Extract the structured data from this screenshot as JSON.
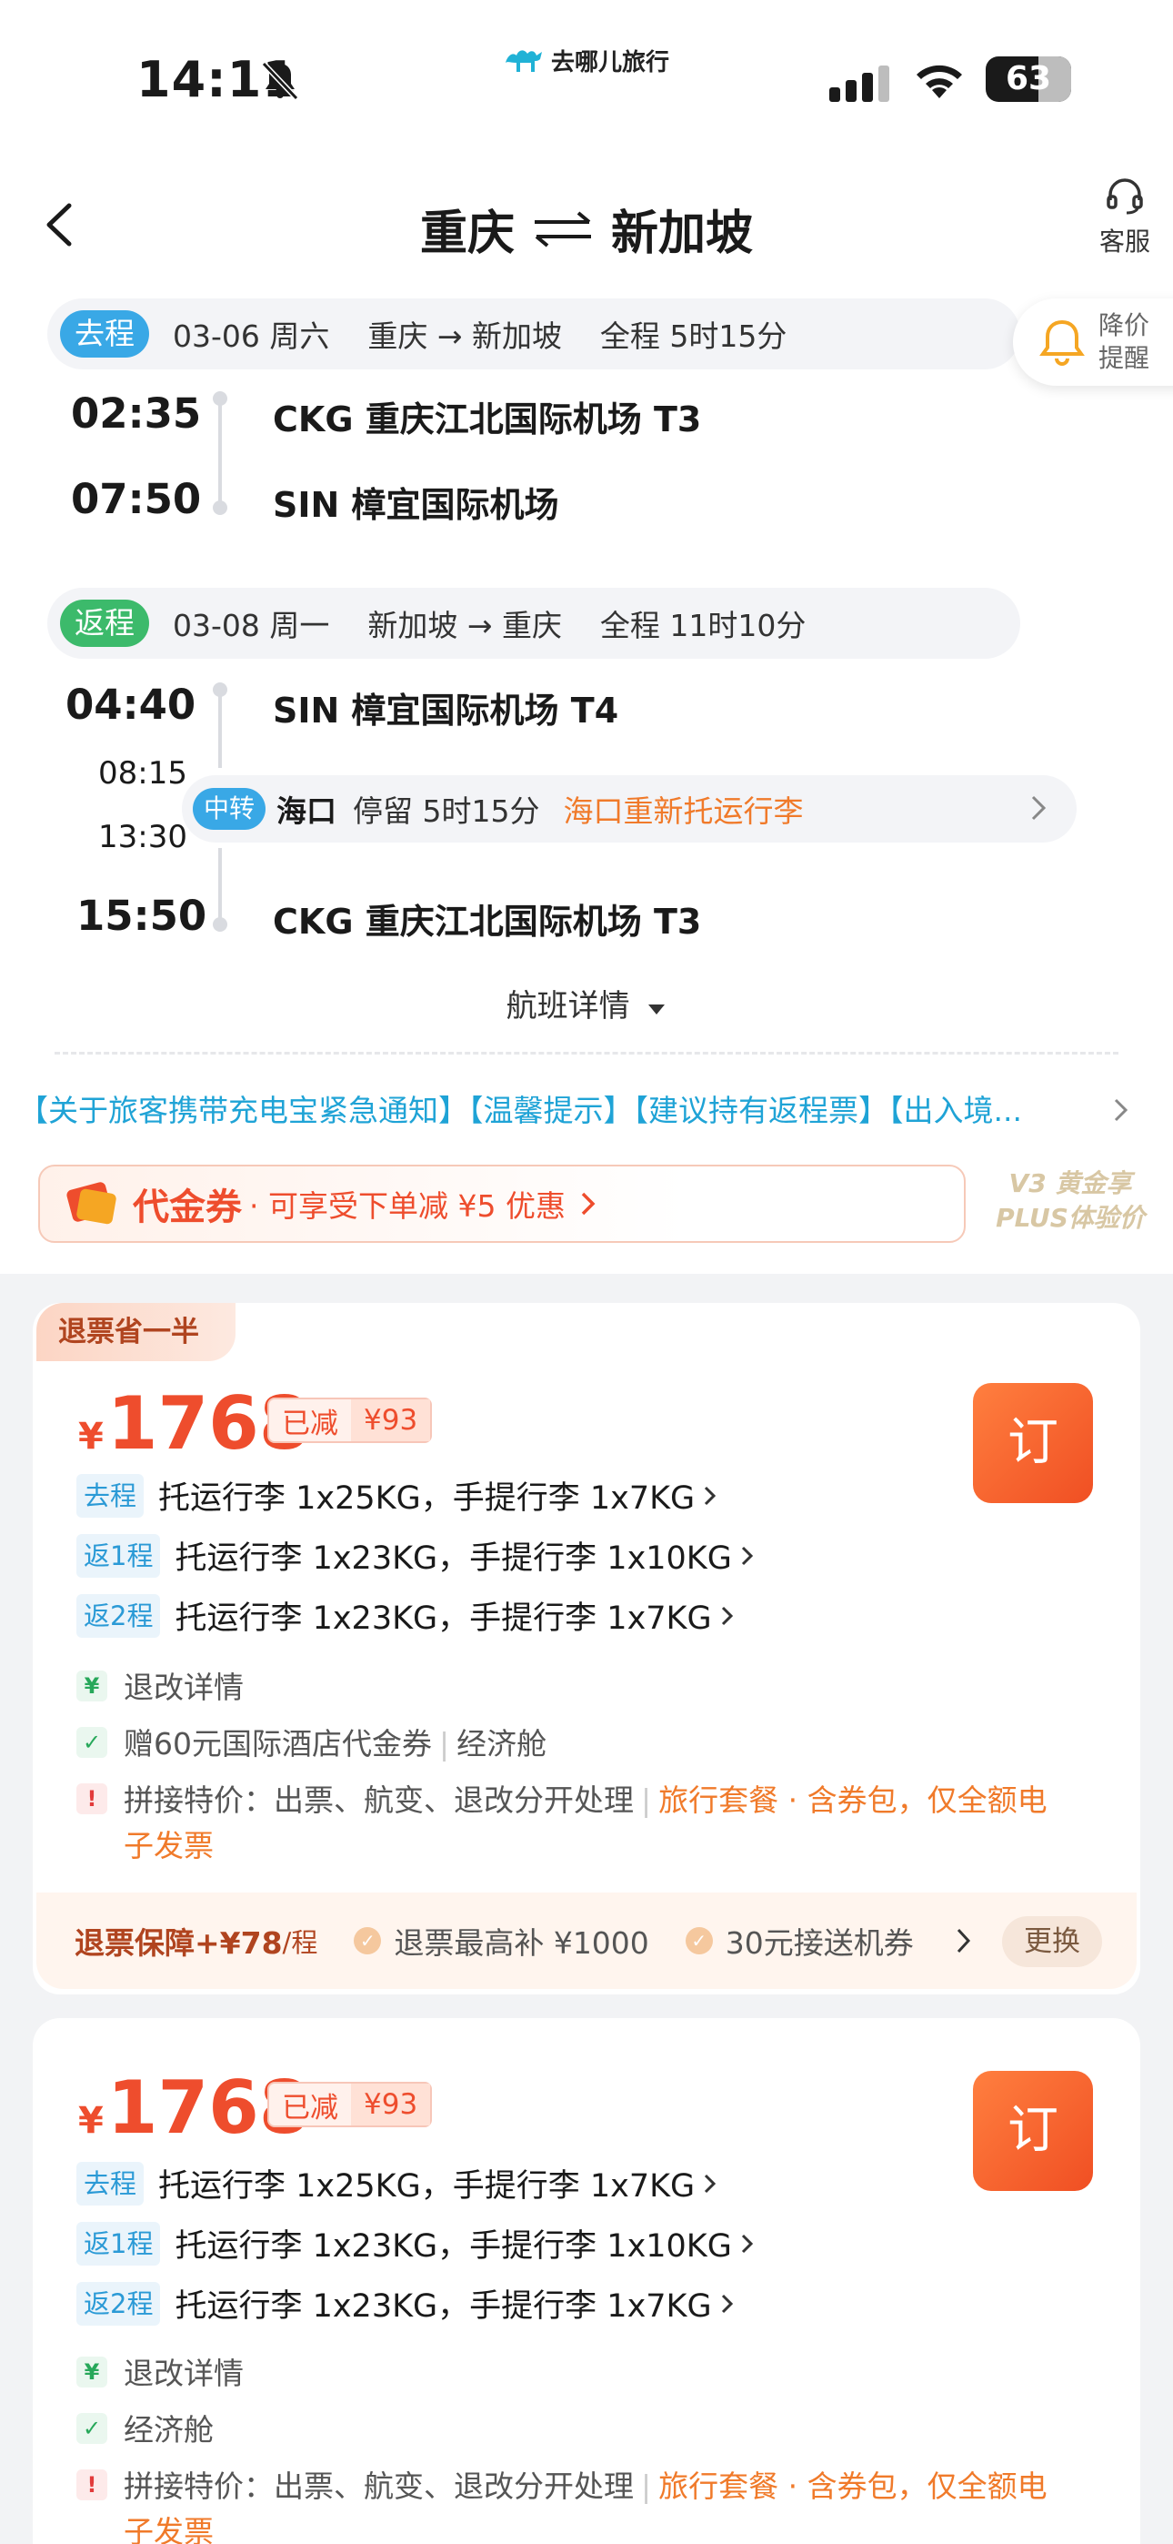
{
  "status_bar": {
    "time": "14:11",
    "battery": "63"
  },
  "brand": {
    "name": "去哪儿旅行"
  },
  "header": {
    "from": "重庆",
    "to": "新加坡",
    "service_label": "客服"
  },
  "price_alert": {
    "label": "降价提醒"
  },
  "outbound": {
    "tag": "去程",
    "summary": "03-06 周六    重庆 → 新加坡    全程 5时15分",
    "dep_time": "02:35",
    "dep_airport": "CKG 重庆江北国际机场 T3",
    "arr_time": "07:50",
    "arr_airport": "SIN 樟宜国际机场"
  },
  "inbound": {
    "tag": "返程",
    "summary": "03-08 周一    新加坡 → 重庆    全程 11时10分",
    "dep_time": "04:40",
    "dep_airport": "SIN 樟宜国际机场 T4",
    "transfer_arr": "08:15",
    "transfer_dep": "13:30",
    "transfer_tag": "中转",
    "transfer_city": "海口",
    "transfer_stay": "停留 5时15分",
    "transfer_note": "海口重新托运行李",
    "arr_time": "15:50",
    "arr_airport": "CKG 重庆江北国际机场 T3"
  },
  "flight_detail_label": "航班详情",
  "notice": "【关于旅客携带充电宝紧急通知】【温馨提示】【建议持有返程票】【出入境...",
  "voucher": {
    "title": "代金券",
    "subtitle": "· 可享受下单减 ¥5 优惠",
    "plus_line1": "V3 黄金享",
    "plus_line2": "PLUS体验价"
  },
  "offers": [
    {
      "badge": "退票省一半",
      "currency": "¥",
      "price": "1768",
      "discount_label": "已减",
      "discount_amount": "¥93",
      "book_label": "订",
      "baggage": [
        {
          "tag": "去程",
          "text": "托运行李 1x25KG，手提行李 1x7KG"
        },
        {
          "tag": "返1程",
          "text": "托运行李 1x23KG，手提行李 1x10KG"
        },
        {
          "tag": "返2程",
          "text": "托运行李 1x23KG，手提行李 1x7KG"
        }
      ],
      "refund_info": "退改详情",
      "gift": "赠60元国际酒店代金券",
      "cabin": "经济舱",
      "note_main": "拼接特价：出票、航变、退改分开处理",
      "note_highlight": "旅行套餐 · 含券包，仅全额电子发票",
      "guarantee": {
        "title": "退票保障+¥78",
        "unit": "/程",
        "item1": "退票最高补 ¥1000",
        "item2": "30元接送机券",
        "change_label": "更换"
      }
    },
    {
      "currency": "¥",
      "price": "1768",
      "discount_label": "已减",
      "discount_amount": "¥93",
      "book_label": "订",
      "baggage": [
        {
          "tag": "去程",
          "text": "托运行李 1x25KG，手提行李 1x7KG"
        },
        {
          "tag": "返1程",
          "text": "托运行李 1x23KG，手提行李 1x10KG"
        },
        {
          "tag": "返2程",
          "text": "托运行李 1x23KG，手提行李 1x7KG"
        }
      ],
      "refund_info": "退改详情",
      "cabin": "经济舱",
      "note_main": "拼接特价：出票、航变、退改分开处理",
      "note_highlight": "旅行套餐 · 含券包，仅全额电子发票"
    }
  ],
  "colors": {
    "accent": "#ee4d2d",
    "blue_tag": "#39a8e6",
    "green_tag": "#3cba6b",
    "notice": "#1fa3d6"
  }
}
